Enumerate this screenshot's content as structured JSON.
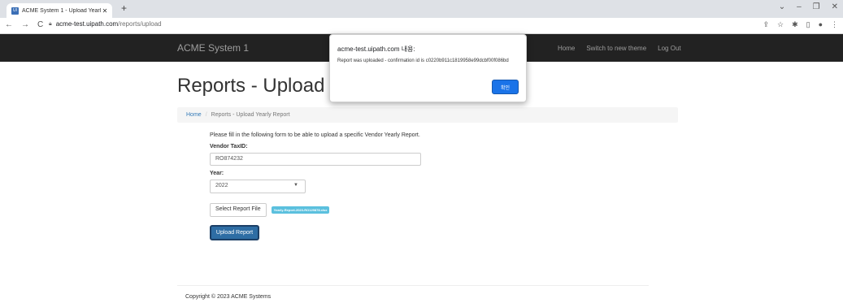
{
  "browser": {
    "tab_title": "ACME System 1 - Upload Yearl",
    "tab_favicon": "UI",
    "url_host": "acme-test.uipath.com",
    "url_path": "/reports/upload"
  },
  "app": {
    "brand": "ACME System 1",
    "nav": [
      "Home",
      "Switch to new theme",
      "Log Out"
    ]
  },
  "page": {
    "title": "Reports - Upload Year",
    "breadcrumb_home": "Home",
    "breadcrumb_current": "Reports - Upload Yearly Report",
    "intro": "Please fill in the following form to be able to upload a specific Vendor Yearly Report.",
    "taxid_label": "Vendor TaxID:",
    "taxid_value": "RO874232",
    "year_label": "Year:",
    "year_value": "2022",
    "select_file_label": "Select Report File",
    "selected_file": "Yearly-Report-2023-RO129878.xlsx",
    "upload_label": "Upload Report",
    "copyright": "Copyright © 2023 ACME Systems"
  },
  "dialog": {
    "title": "acme-test.uipath.com 내용:",
    "message": "Report was uploaded - confirmation id is c0220b911c1819958e99dcbf00f086bd",
    "ok_label": "확인"
  }
}
